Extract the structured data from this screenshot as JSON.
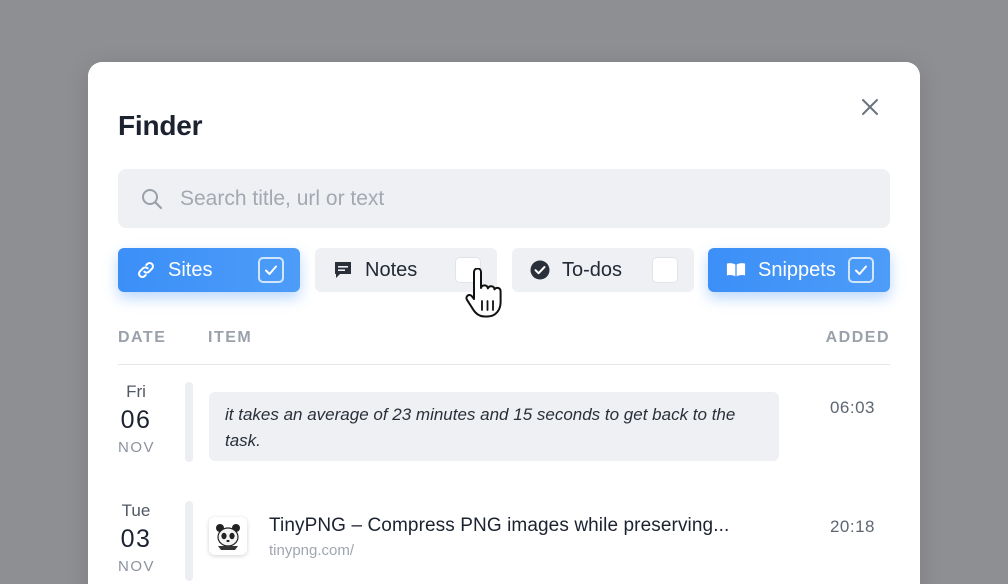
{
  "modal": {
    "title": "Finder"
  },
  "search": {
    "placeholder": "Search title, url or text",
    "value": ""
  },
  "filters": [
    {
      "label": "Sites",
      "icon": "link-icon",
      "checked": true
    },
    {
      "label": "Notes",
      "icon": "comment-icon",
      "checked": false
    },
    {
      "label": "To-dos",
      "icon": "check-circle-icon",
      "checked": false
    },
    {
      "label": "Snippets",
      "icon": "book-open-icon",
      "checked": true
    }
  ],
  "table": {
    "headers": {
      "date": "DATE",
      "item": "ITEM",
      "added": "ADDED"
    },
    "rows": [
      {
        "weekday": "Fri",
        "day": "06",
        "month": "NOV",
        "type": "snippet",
        "text": "it takes an average of 23 minutes and 15 seconds to get back to the task.",
        "time": "06:03"
      },
      {
        "weekday": "Tue",
        "day": "03",
        "month": "NOV",
        "type": "site",
        "title": "TinyPNG – Compress PNG images while preserving...",
        "url": "tinypng.com/",
        "time": "20:18"
      }
    ]
  },
  "colors": {
    "backdrop": "#8e8f92",
    "accent": "#3b8ff7",
    "chip_bg": "#eef0f3",
    "text": "#1c2230"
  }
}
